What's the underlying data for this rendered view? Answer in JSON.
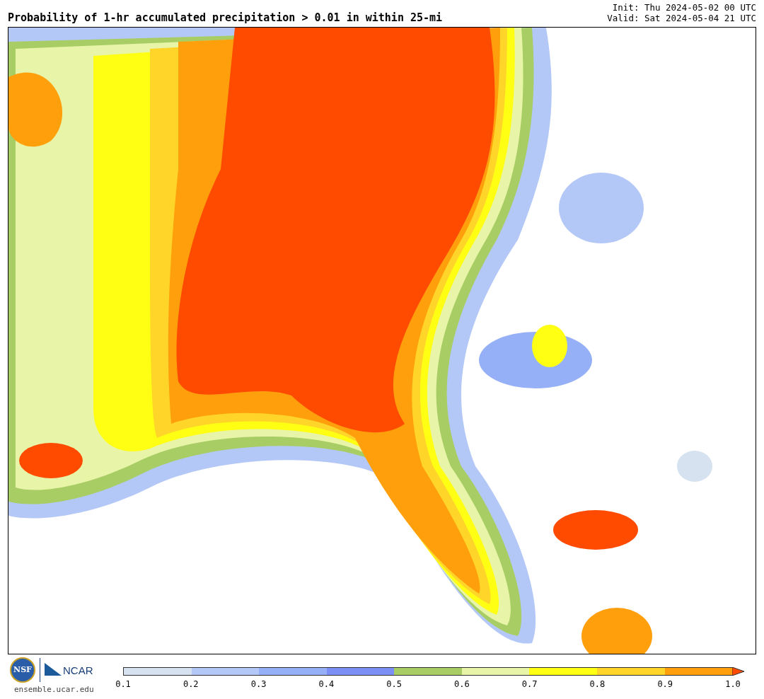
{
  "title": "Probability of 1-hr accumulated precipitation > 0.01 in within 25-mi",
  "init": "Init: Thu 2024-05-02 00 UTC",
  "valid": "Valid: Sat 2024-05-04 21 UTC",
  "logos": {
    "nsf": "NSF",
    "ncar": "NCAR",
    "url": "ensemble.ucar.edu"
  },
  "colorbar": {
    "bins": [
      {
        "color": "#d6e2ef"
      },
      {
        "color": "#b4c8f8"
      },
      {
        "color": "#96b0f8"
      },
      {
        "color": "#7b8ff4"
      },
      {
        "color": "#a8cd64"
      },
      {
        "color": "#e8f5a8"
      },
      {
        "color": "#ffff14"
      },
      {
        "color": "#ffd52a"
      },
      {
        "color": "#ff9f0c"
      }
    ],
    "over": {
      "color": "#ff4b00"
    },
    "ticks": [
      "0.1",
      "0.2",
      "0.3",
      "0.4",
      "0.5",
      "0.6",
      "0.7",
      "0.8",
      "0.9",
      "1.0"
    ]
  }
}
